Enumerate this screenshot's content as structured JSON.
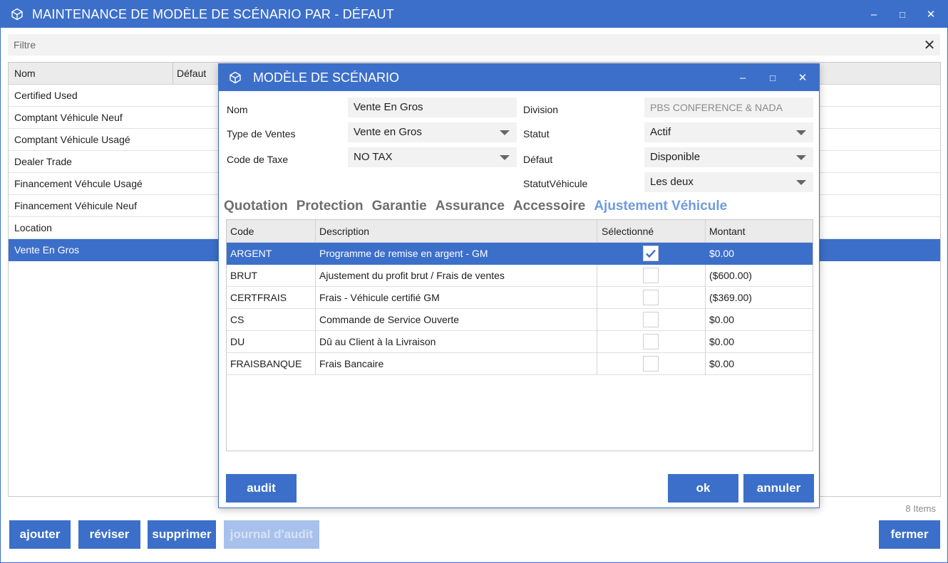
{
  "window": {
    "title": "MAINTENANCE DE MODÈLE DE SCÉNARIO PAR - DÉFAUT",
    "minimize": "–",
    "maximize": "□",
    "close": "✕"
  },
  "filter": {
    "label": "Filtre",
    "clear": "✕"
  },
  "list": {
    "columns": [
      "Nom",
      "Défaut"
    ],
    "items": [
      "Certified Used",
      "Comptant Véhicule Neuf",
      "Comptant Véhicule Usagé",
      "Dealer Trade",
      "Financement Véhcule Usagé",
      "Financement Véhicule Neuf",
      "Location",
      "Vente En Gros"
    ],
    "selected_index": 7,
    "count_label": "8 Items"
  },
  "buttons": {
    "ajouter": "ajouter",
    "reviser": "réviser",
    "supprimer": "supprimer",
    "journal": "journal d'audit",
    "fermer": "fermer"
  },
  "dialog": {
    "title": "MODÈLE DE SCÉNARIO",
    "minimize": "–",
    "maximize": "□",
    "close": "✕",
    "fields": {
      "nom_label": "Nom",
      "nom_value": "Vente En Gros",
      "type_label": "Type de Ventes",
      "type_value": "Vente en Gros",
      "taxe_label": "Code de Taxe",
      "taxe_value": "NO TAX",
      "division_label": "Division",
      "division_value": "PBS CONFERENCE & NADA",
      "statut_label": "Statut",
      "statut_value": "Actif",
      "defaut_label": "Défaut",
      "defaut_value": "Disponible",
      "statutvehicule_label": "StatutVéhicule",
      "statutvehicule_value": "Les deux"
    },
    "tabs": [
      "Quotation",
      "Protection",
      "Garantie",
      "Assurance",
      "Accessoire",
      "Ajustement Véhicule"
    ],
    "active_tab": 5,
    "grid": {
      "columns": {
        "code": "Code",
        "description": "Description",
        "selected": "Sélectionné",
        "amount": "Montant"
      },
      "rows": [
        {
          "code": "ARGENT",
          "description": "Programme de remise en argent - GM",
          "checked": true,
          "amount": "$0.00"
        },
        {
          "code": "BRUT",
          "description": "Ajustement du profit brut / Frais de ventes",
          "checked": false,
          "amount": "($600.00)"
        },
        {
          "code": "CERTFRAIS",
          "description": "Frais - Véhicule certifié GM",
          "checked": false,
          "amount": "($369.00)"
        },
        {
          "code": "CS",
          "description": "Commande de Service Ouverte",
          "checked": false,
          "amount": "$0.00"
        },
        {
          "code": "DU",
          "description": "Dû au Client à la Livraison",
          "checked": false,
          "amount": "$0.00"
        },
        {
          "code": "FRAISBANQUE",
          "description": "Frais Bancaire",
          "checked": false,
          "amount": "$0.00"
        }
      ],
      "selected_index": 0
    },
    "buttons": {
      "audit": "audit",
      "ok": "ok",
      "annuler": "annuler"
    }
  },
  "colors": {
    "accent": "#3c6fc9",
    "active_tab": "#6f9be0",
    "disabled_button": "#a8c1ec"
  },
  "icons": {
    "app": "cube-icon",
    "check": "checkmark-icon",
    "dropdown": "caret-down-icon"
  }
}
